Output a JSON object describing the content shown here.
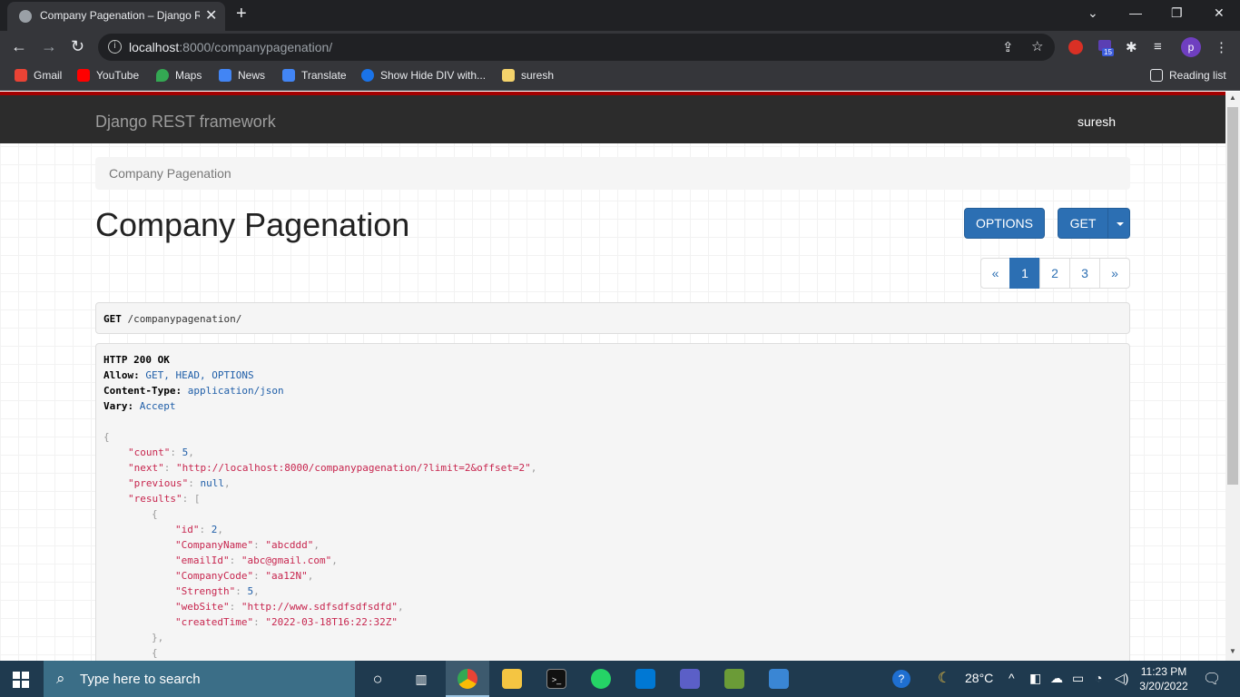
{
  "browser": {
    "tab_title": "Company Pagenation – Django REST framework",
    "tab_close": "✕",
    "new_tab": "+",
    "url_host": "localhost",
    "url_rest": ":8000/companypagenation/",
    "bookmarks": [
      {
        "label": "Gmail",
        "color": "#ea4335"
      },
      {
        "label": "YouTube",
        "color": "#ff0000"
      },
      {
        "label": "Maps",
        "color": "#34a853"
      },
      {
        "label": "News",
        "color": "#4285f4"
      },
      {
        "label": "Translate",
        "color": "#4285f4"
      },
      {
        "label": "Show Hide DIV with...",
        "color": "#1a73e8"
      },
      {
        "label": "suresh",
        "color": "#f4d36b"
      }
    ],
    "reading_list": "Reading list",
    "profile_initial": "p",
    "extension_badge": "15"
  },
  "navbar": {
    "brand": "Django REST framework",
    "user": "suresh"
  },
  "breadcrumb": "Company Pagenation",
  "page_title": "Company Pagenation",
  "buttons": {
    "options": "OPTIONS",
    "get": "GET"
  },
  "pagination": {
    "prev": "«",
    "pages": [
      "1",
      "2",
      "3"
    ],
    "next": "»",
    "active": "1"
  },
  "request": {
    "method": "GET",
    "path": "/companypagenation/"
  },
  "response": {
    "status": "HTTP 200 OK",
    "headers": [
      {
        "name": "Allow:",
        "value": "GET, HEAD, OPTIONS"
      },
      {
        "name": "Content-Type:",
        "value": "application/json"
      },
      {
        "name": "Vary:",
        "value": "Accept"
      }
    ],
    "body": {
      "count": "5",
      "next": "\"http://localhost:8000/companypagenation/?limit=2&offset=2\"",
      "previous": "null",
      "result_item": {
        "id": "2",
        "CompanyName": "\"abcddd\"",
        "emailId": "\"abc@gmail.com\"",
        "CompanyCode": "\"aa12N\"",
        "Strength": "5",
        "webSite": "\"http://www.sdfsdfsdfsdfd\"",
        "createdTime": "\"2022-03-18T16:22:32Z\""
      }
    }
  },
  "taskbar": {
    "search_placeholder": "Type here to search",
    "weather": "28°C",
    "time": "11:23 PM",
    "date": "3/20/2022"
  }
}
